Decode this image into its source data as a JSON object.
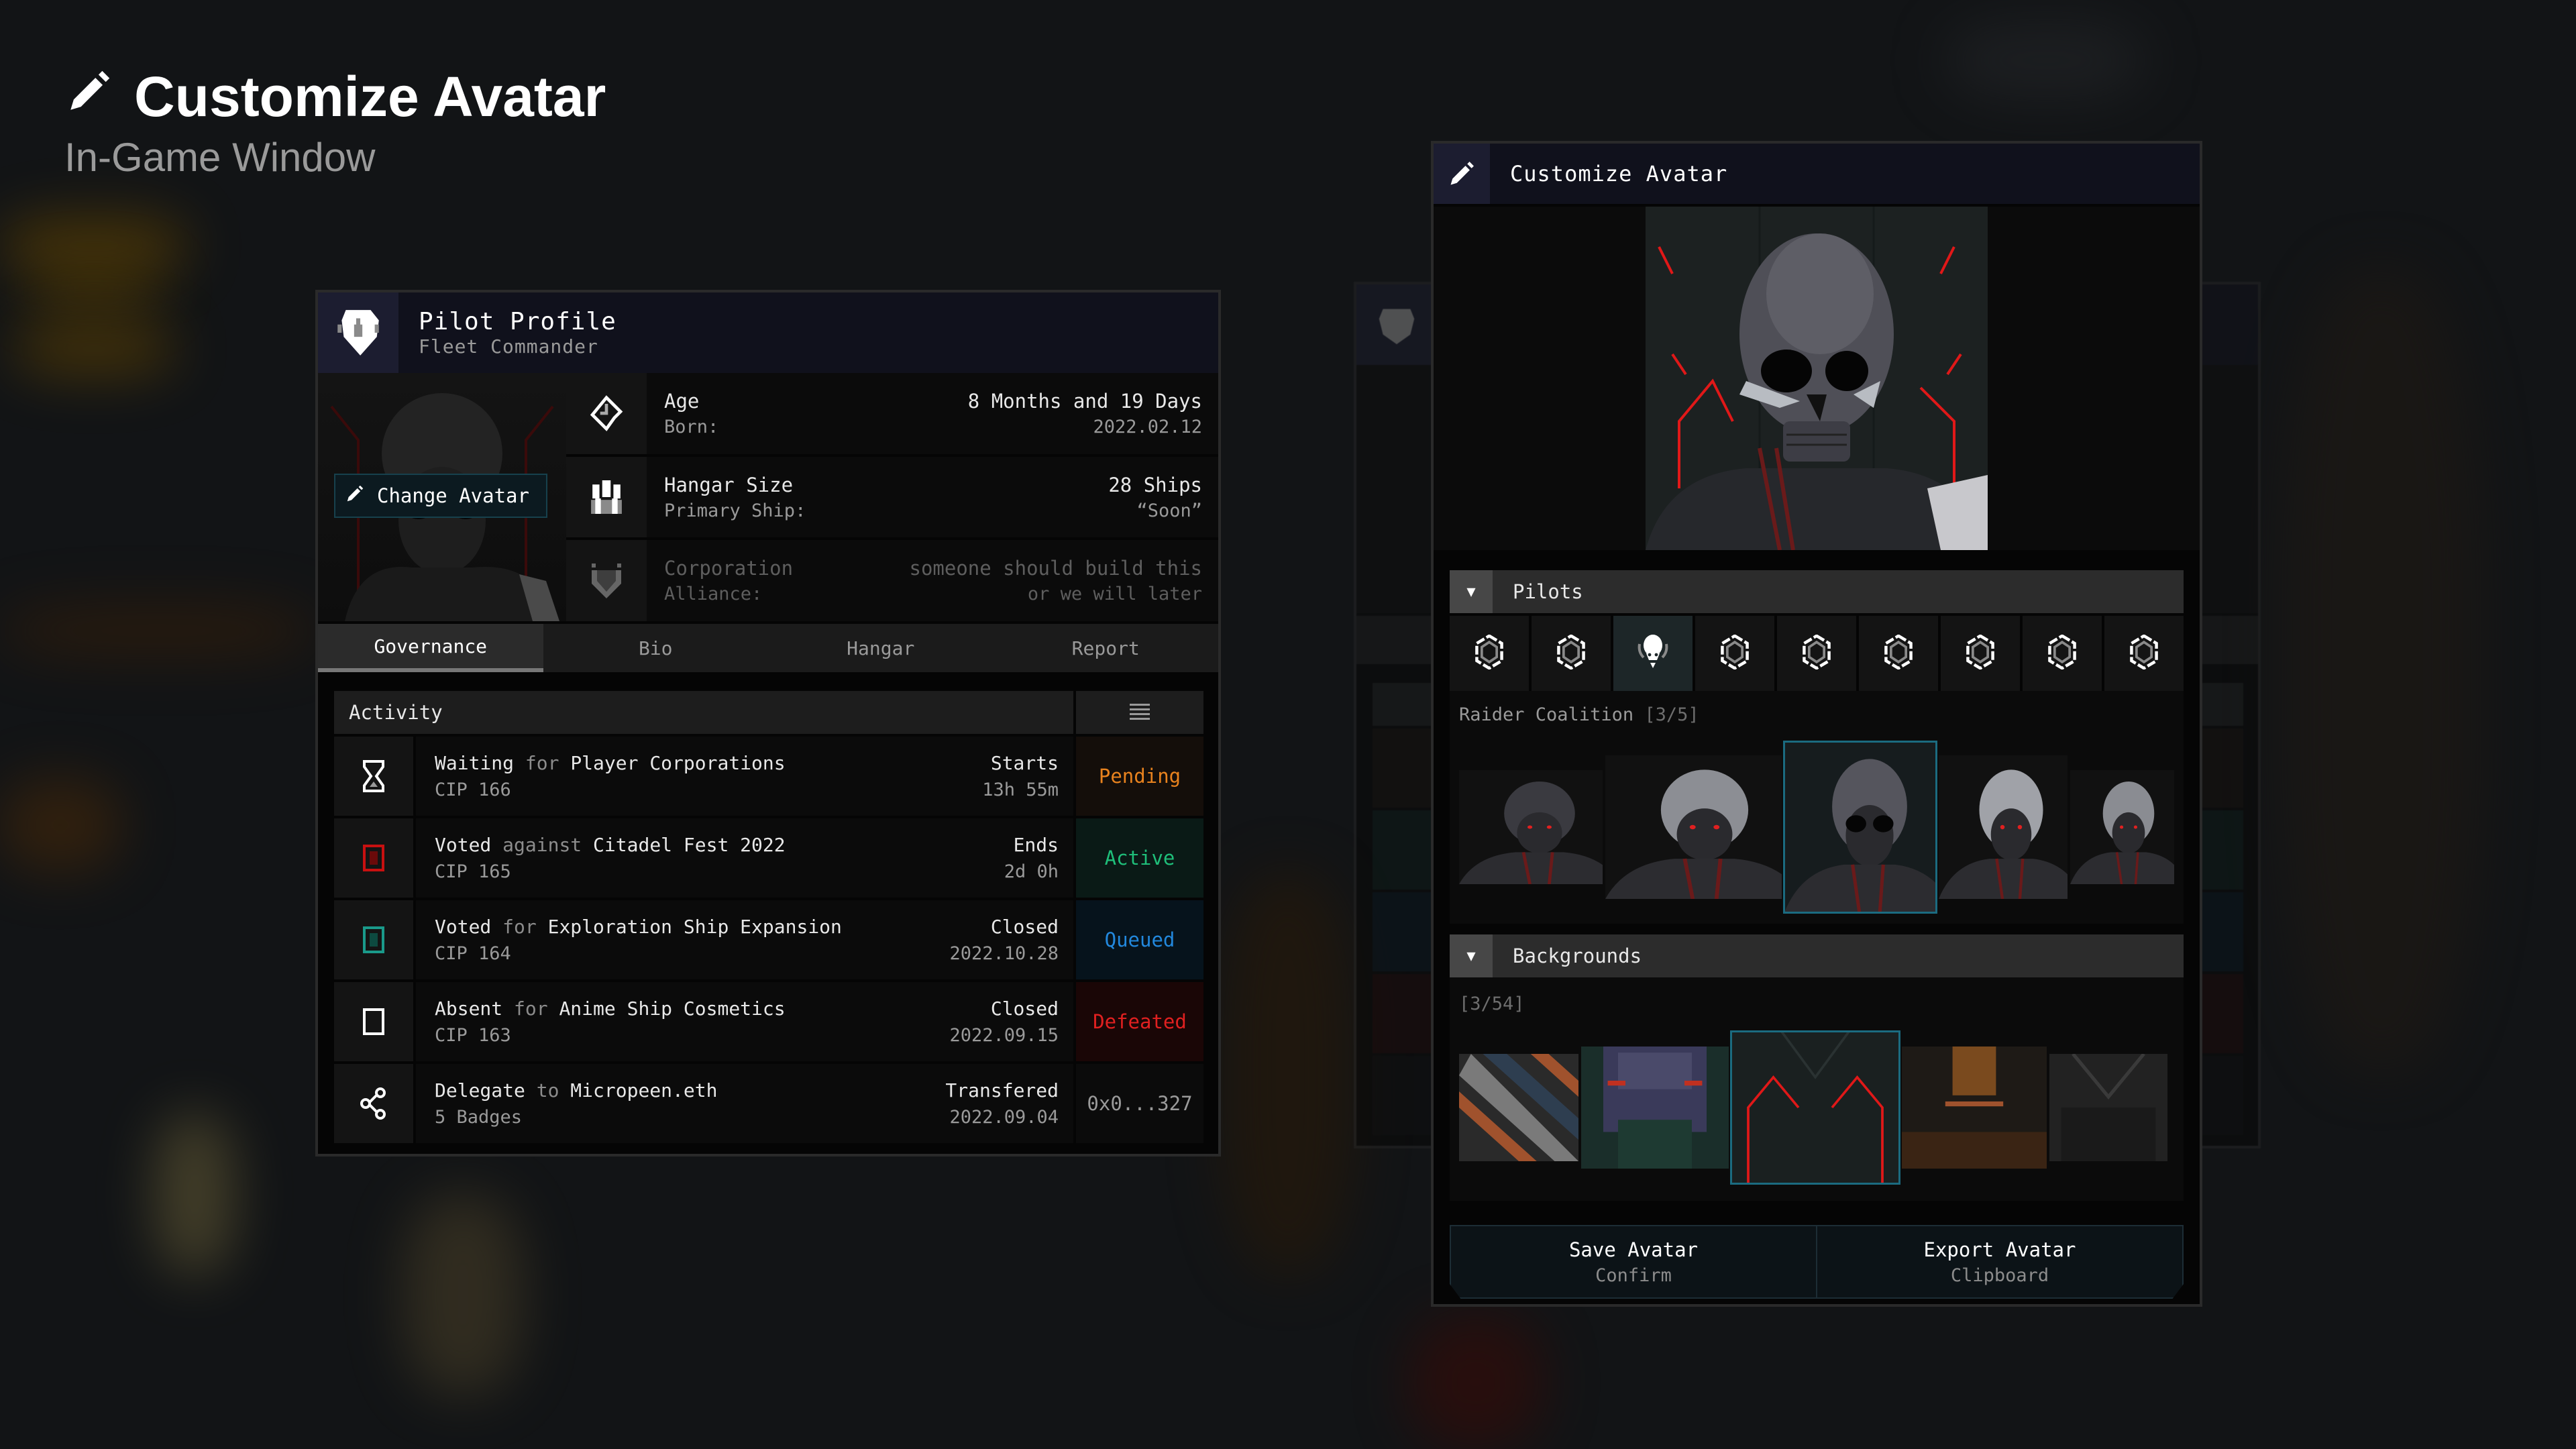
{
  "page": {
    "title": "Customize Avatar",
    "subtitle": "In-Game Window",
    "title_icon": "pencil-icon"
  },
  "pilot_profile": {
    "title": "Pilot Profile",
    "subtitle": "Fleet Commander",
    "header_icon": "raider-emblem-icon",
    "change_avatar_label": "Change Avatar",
    "stats": [
      {
        "icon": "clock-diamond-icon",
        "label": "Age",
        "sublabel": "Born:",
        "value": "8 Months and 19 Days",
        "subvalue": "2022.02.12"
      },
      {
        "icon": "ship-hangar-icon",
        "label": "Hangar Size",
        "sublabel": "Primary Ship:",
        "value": "28 Ships",
        "subvalue": "“Soon”"
      },
      {
        "icon": "shield-banner-icon",
        "label": "Corporation",
        "sublabel": "Alliance:",
        "value": "someone should build this",
        "subvalue": "or we will later"
      }
    ],
    "tabs": [
      {
        "label": "Governance",
        "active": true
      },
      {
        "label": "Bio",
        "active": false
      },
      {
        "label": "Hangar",
        "active": false
      },
      {
        "label": "Report",
        "active": false
      }
    ],
    "activity": {
      "title": "Activity",
      "menu_icon": "menu-icon",
      "rows": [
        {
          "icon": "hourglass-icon",
          "verb": "Waiting",
          "prep": "for",
          "subject": "Player Corporations",
          "sub": "CIP 166",
          "time_label": "Starts",
          "time_value": "13h 55m",
          "status": "Pending",
          "status_color": "#e8821e",
          "status_bg": "#140e0a"
        },
        {
          "icon": "vote-against-icon",
          "verb": "Voted",
          "prep": "against",
          "subject": "Citadel Fest 2022",
          "sub": "CIP 165",
          "time_label": "Ends",
          "time_value": "2d 0h",
          "status": "Active",
          "status_color": "#1fbf7a",
          "status_bg": "#0a1a16"
        },
        {
          "icon": "vote-for-icon",
          "verb": "Voted",
          "prep": "for",
          "subject": "Exploration Ship Expansion",
          "sub": "CIP 164",
          "time_label": "Closed",
          "time_value": "2022.10.28",
          "status": "Queued",
          "status_color": "#2288dd",
          "status_bg": "#06131c"
        },
        {
          "icon": "absent-box-icon",
          "verb": "Absent",
          "prep": "for",
          "subject": "Anime Ship Cosmetics",
          "sub": "CIP 163",
          "time_label": "Closed",
          "time_value": "2022.09.15",
          "status": "Defeated",
          "status_color": "#e02020",
          "status_bg": "#1a0606"
        },
        {
          "icon": "share-icon",
          "verb": "Delegate",
          "prep": "to",
          "subject": "Micropeen.eth",
          "sub": "5 Badges",
          "time_label": "Transfered",
          "time_value": "2022.09.04",
          "status": "0x0...327",
          "status_color": "#9a9a9a",
          "status_bg": "#0b0b0b"
        }
      ]
    }
  },
  "customize_window": {
    "title": "Customize Avatar",
    "header_icon": "pencil-icon",
    "pilots_section": {
      "title": "Pilots",
      "faction_icons": [
        "hexagon-faction-icon",
        "hexagon-faction-icon",
        "skull-faction-icon",
        "hexagon-faction-icon",
        "hexagon-faction-icon",
        "hexagon-faction-icon",
        "hexagon-faction-icon",
        "hexagon-faction-icon",
        "hexagon-faction-icon"
      ],
      "selected_faction_index": 2,
      "faction_label": "Raider Coalition",
      "faction_count": "[3/5]",
      "portraits": [
        "Raider pilot 1",
        "Raider pilot 2",
        "Raider pilot 3 (skull)",
        "Raider pilot 4",
        "Raider pilot 5"
      ],
      "selected_portrait_index": 2
    },
    "backgrounds_section": {
      "title": "Backgrounds",
      "count": "[3/54]",
      "items": [
        "orange-blue stripes",
        "green-purple hull",
        "dark teal red-line",
        "orange hull",
        "dark grey hull"
      ],
      "selected_index": 2
    },
    "buttons": [
      {
        "label": "Save Avatar",
        "sub": "Confirm"
      },
      {
        "label": "Export Avatar",
        "sub": "Clipboard"
      }
    ]
  },
  "colors": {
    "accent_teal": "#1b6b80",
    "header_bg": "#10111c",
    "pending": "#e8821e",
    "active": "#1fbf7a",
    "queued": "#2288dd",
    "defeated": "#e02020"
  }
}
